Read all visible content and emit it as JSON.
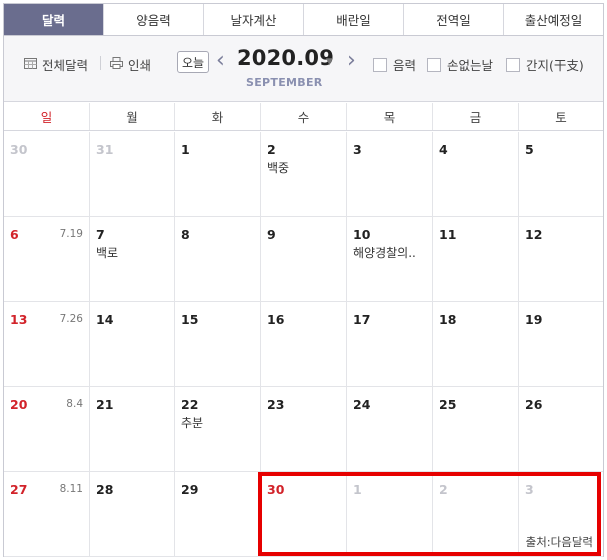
{
  "tabs": [
    {
      "label": "달력",
      "active": true
    },
    {
      "label": "양음력",
      "active": false
    },
    {
      "label": "날자계산",
      "active": false
    },
    {
      "label": "배란일",
      "active": false
    },
    {
      "label": "전역일",
      "active": false
    },
    {
      "label": "출산예정일",
      "active": false
    }
  ],
  "toolbar": {
    "full_calendar": "전체달력",
    "print": "인쇄",
    "today": "오늘",
    "year_month": "2020.09",
    "month_en": "SEPTEMBER",
    "options": [
      "음력",
      "손없는날",
      "간지(干支)"
    ]
  },
  "weekdays": [
    "일",
    "월",
    "화",
    "수",
    "목",
    "금",
    "토"
  ],
  "weeks": [
    [
      {
        "day": "30",
        "style": "gray"
      },
      {
        "day": "31",
        "style": "gray"
      },
      {
        "day": "1"
      },
      {
        "day": "2",
        "event": "백중"
      },
      {
        "day": "3"
      },
      {
        "day": "4"
      },
      {
        "day": "5"
      }
    ],
    [
      {
        "day": "6",
        "style": "red",
        "lunar": "7.19"
      },
      {
        "day": "7",
        "event": "백로"
      },
      {
        "day": "8"
      },
      {
        "day": "9"
      },
      {
        "day": "10",
        "event": "해양경찰의.."
      },
      {
        "day": "11"
      },
      {
        "day": "12"
      }
    ],
    [
      {
        "day": "13",
        "style": "red",
        "lunar": "7.26"
      },
      {
        "day": "14"
      },
      {
        "day": "15"
      },
      {
        "day": "16"
      },
      {
        "day": "17"
      },
      {
        "day": "18"
      },
      {
        "day": "19"
      }
    ],
    [
      {
        "day": "20",
        "style": "red",
        "lunar": "8.4"
      },
      {
        "day": "21"
      },
      {
        "day": "22",
        "event": "추분"
      },
      {
        "day": "23"
      },
      {
        "day": "24"
      },
      {
        "day": "25"
      },
      {
        "day": "26"
      }
    ],
    [
      {
        "day": "27",
        "style": "red",
        "lunar": "8.11"
      },
      {
        "day": "28"
      },
      {
        "day": "29"
      },
      {
        "day": "30",
        "style": "red"
      },
      {
        "day": "1",
        "style": "gray"
      },
      {
        "day": "2",
        "style": "gray"
      },
      {
        "day": "3",
        "style": "gray"
      }
    ]
  ],
  "source": "출처:다음달력",
  "colors": {
    "tab_active": "#6a6d8e",
    "sunday": "#d2232a",
    "highlight": "#e60000"
  }
}
